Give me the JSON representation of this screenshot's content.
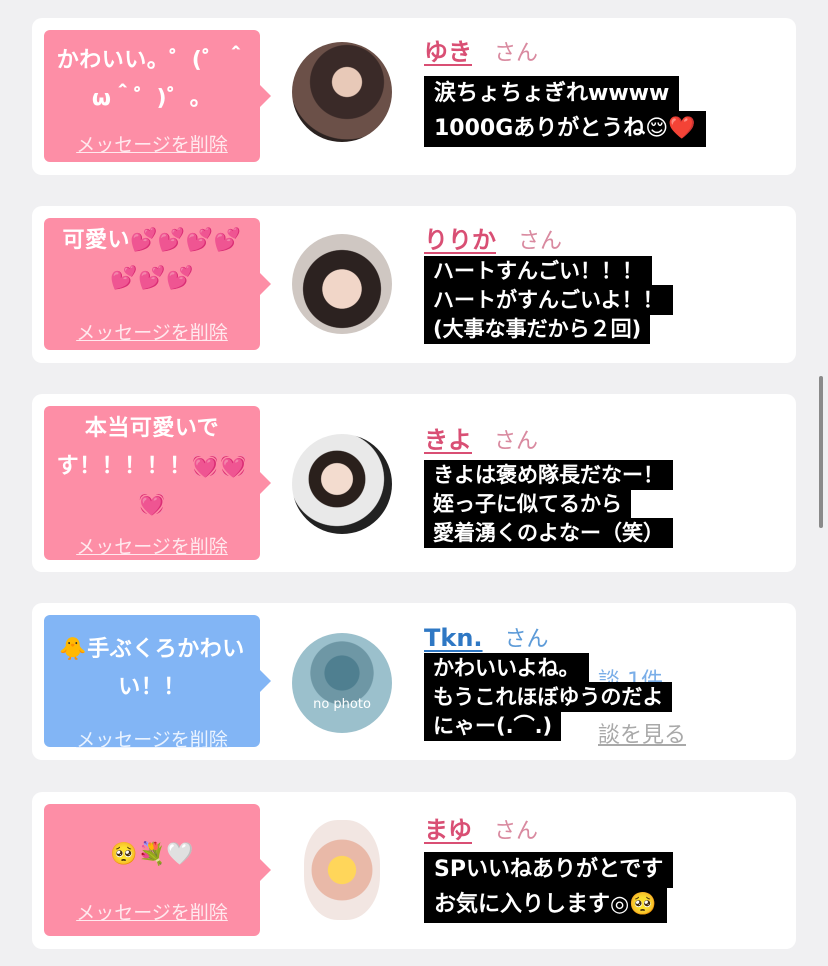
{
  "colors": {
    "bubble_pink": "#fd8ea6",
    "bubble_blue": "#82b5f5",
    "name_pink": "#d94f74",
    "name_blue": "#2f78c4"
  },
  "delete_label": "メッセージを削除",
  "honorific": "さん",
  "cards": [
    {
      "bubble_text": "かわいい。゜(゜＾ω＾゜)゜。",
      "name": "ゆき",
      "caption": [
        "涙ちょちょぎれwwww",
        "1000Gありがとうね😌❤️"
      ]
    },
    {
      "bubble_text": "可愛い💕💕💕💕💕💕💕",
      "name": "りりか",
      "caption": [
        "ハートすんごい！！！",
        "ハートがすんごいよ！！",
        "(大事な事だから２回)"
      ]
    },
    {
      "bubble_text": "本当可愛いです！！！！！💓💓💓",
      "name": "きよ",
      "caption": [
        "きよは褒め隊長だなー！",
        "姪っ子に似てるから",
        "愛着湧くのよなー（笑）"
      ]
    },
    {
      "bubble_text": "🐥手ぶくろかわいい！！",
      "name": "Tkn.",
      "avatar_text": "no photo",
      "behind_text": "談 1件",
      "behind_link": "談を見る",
      "caption": [
        "かわいいよね。",
        "もうこれほぼゆうのだよ",
        "にゃー(.⌒.)"
      ]
    },
    {
      "bubble_text": "🥺💐🤍",
      "name": "まゆ",
      "caption": [
        "SPいいねありがとです",
        "お気に入りします◎🥺"
      ]
    }
  ]
}
